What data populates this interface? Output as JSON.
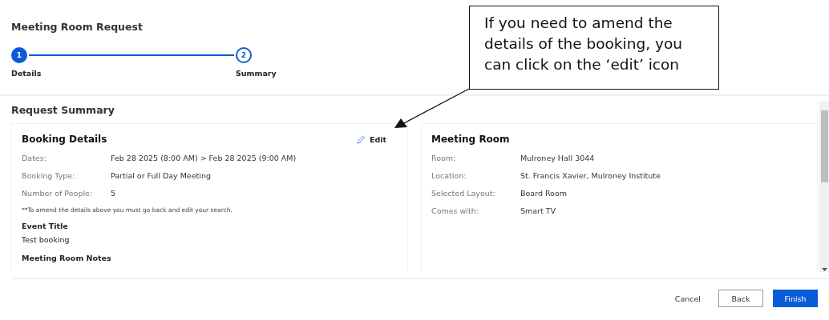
{
  "title": "Meeting Room Request",
  "steps": [
    {
      "number": "1",
      "label": "Details",
      "selected": true
    },
    {
      "number": "2",
      "label": "Summary",
      "selected": false
    }
  ],
  "section_title": "Request Summary",
  "booking_details": {
    "title": "Booking Details",
    "edit_label": "Edit",
    "fields": [
      {
        "label": "Dates:",
        "value": "Feb 28 2025 (8:00 AM) > Feb 28 2025 (9:00 AM)"
      },
      {
        "label": "Booking Type:",
        "value": "Partial or Full Day Meeting"
      },
      {
        "label": "Number of People:",
        "value": "5"
      }
    ],
    "note": "**To amend the details above you must go back and edit your search.",
    "event_title_label": "Event Title",
    "event_title": "Test booking",
    "notes_label": "Meeting Room Notes"
  },
  "meeting_room": {
    "title": "Meeting Room",
    "fields": [
      {
        "label": "Room:",
        "value": "Mulroney Hall 3044"
      },
      {
        "label": "Location:",
        "value": "St. Francis Xavier, Mulroney Institute"
      },
      {
        "label": "Selected Layout:",
        "value": "Board Room"
      },
      {
        "label": "Comes with:",
        "value": "Smart TV"
      }
    ]
  },
  "buttons": [
    {
      "label": "Cancel",
      "kind": "text"
    },
    {
      "label": "Back",
      "kind": "outline"
    },
    {
      "label": "Finish",
      "kind": "primary"
    }
  ],
  "callout": {
    "text": "If you need to amend the details of the booking, you can click on the ‘edit’ icon"
  }
}
